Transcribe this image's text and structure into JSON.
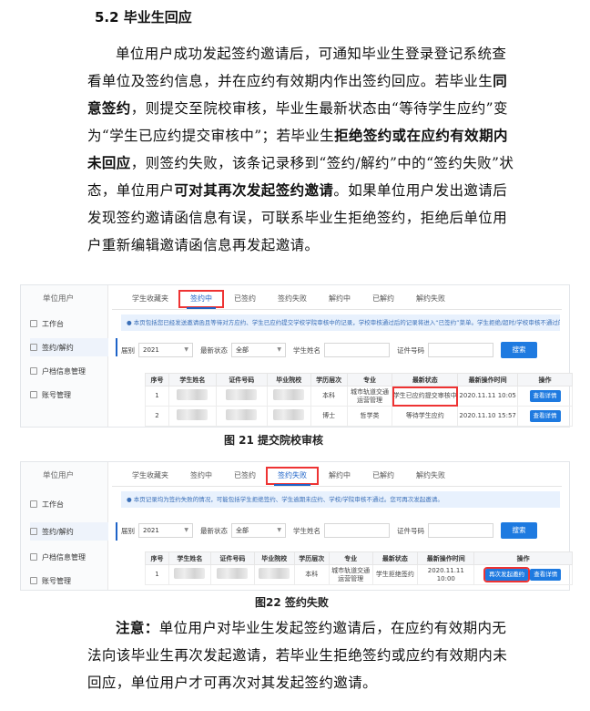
{
  "heading": "5.2  毕业生回应",
  "paragraph1": [
    {
      "t": "单位用户成功发起签约邀请后，可通知毕业生登录登记系统查看单位及签约信息，并在应约有效期内作出签约回应。若毕业生",
      "b": false
    },
    {
      "t": "同意签约",
      "b": true
    },
    {
      "t": "，则提交至院校审核，毕业生最新状态由“等待学生应约”变为“学生已应约提交审核中”；若毕业生",
      "b": false
    },
    {
      "t": "拒绝签约或在应约有效期内未回应",
      "b": true
    },
    {
      "t": "，则签约失败，该条记录移到“签约/解约”中的“签约失败”状态，单位用户",
      "b": false
    },
    {
      "t": "可对其再次发起签约邀请",
      "b": true
    },
    {
      "t": "。如果单位用户发出邀请后发现签约邀请函信息有误，可联系毕业生拒绝签约，拒绝后单位用户重新编辑邀请函信息再发起邀请。",
      "b": false
    }
  ],
  "fig21": {
    "sidebar_title": "单位用户",
    "sidebar_items": [
      "工作台",
      "签约/解约",
      "户档信息管理",
      "账号管理"
    ],
    "tabs": [
      "学生收藏夹",
      "签约中",
      "已签约",
      "签约失败",
      "解约中",
      "已解约",
      "解约失败"
    ],
    "notice": "● 本页包括您已经发送邀请函且等待对方应约、学生已应约提交学校学院审核中的记录，学校审核通过后的记录将进入“已签约”菜单。学生拒绝/超时/学校审核不通过的记录将进入“签约失败”菜单。",
    "filters": {
      "year_label": "届别",
      "year_value": "2021",
      "status_label": "最新状态",
      "status_value": "全部",
      "name_label": "学生姓名",
      "cert_label": "证件号码",
      "search": "搜索"
    },
    "columns": [
      "序号",
      "学生姓名",
      "证件号码",
      "毕业院校",
      "学历层次",
      "专业",
      "最新状态",
      "最新操作时间",
      "操作"
    ],
    "rows": [
      {
        "no": "1",
        "level": "本科",
        "major": "城市轨道交通运营管理",
        "status": "学生已应约提交审核中",
        "time": "2020.11.11 10:05",
        "action": "查看详情"
      },
      {
        "no": "2",
        "level": "博士",
        "major": "哲学类",
        "status": "等待学生应约",
        "time": "2020.11.10 15:57",
        "action": "查看详情"
      }
    ],
    "caption": "图 21  提交院校审核"
  },
  "fig22": {
    "sidebar_title": "单位用户",
    "sidebar_items": [
      "工作台",
      "签约/解约",
      "户档信息管理",
      "账号管理"
    ],
    "tabs": [
      "学生收藏夹",
      "签约中",
      "已签约",
      "签约失败",
      "解约中",
      "已解约",
      "解约失败"
    ],
    "notice": "● 本页记录均为签约失败的情况，可能包括学生拒绝签约、学生逾期未应约、学校/学院审核不通过。您可再次发起邀请。",
    "filters": {
      "year_label": "届别",
      "year_value": "2021",
      "status_label": "最新状态",
      "status_value": "全部",
      "name_label": "学生姓名",
      "cert_label": "证件号码",
      "search": "搜索"
    },
    "columns": [
      "序号",
      "学生姓名",
      "证件号码",
      "毕业院校",
      "学历层次",
      "专业",
      "最新状态",
      "最新操作时间",
      "操作"
    ],
    "rows": [
      {
        "no": "1",
        "level": "本科",
        "major": "城市轨道交通运营管理",
        "status": "学生拒绝签约",
        "time": "2020.11.11 10:00",
        "action1": "再次发起邀约",
        "action2": "查看详情"
      }
    ],
    "caption": "图22  签约失败"
  },
  "note_label": "注意：",
  "note_text": "单位用户对毕业生发起签约邀请后，在应约有效期内无法向该毕业生再次发起邀请，若毕业生拒绝签约或应约有效期内未回应，单位用户才可再次对其发起签约邀请。",
  "colors": {
    "accent": "#1e7ae0",
    "highlight": "#e33333"
  }
}
